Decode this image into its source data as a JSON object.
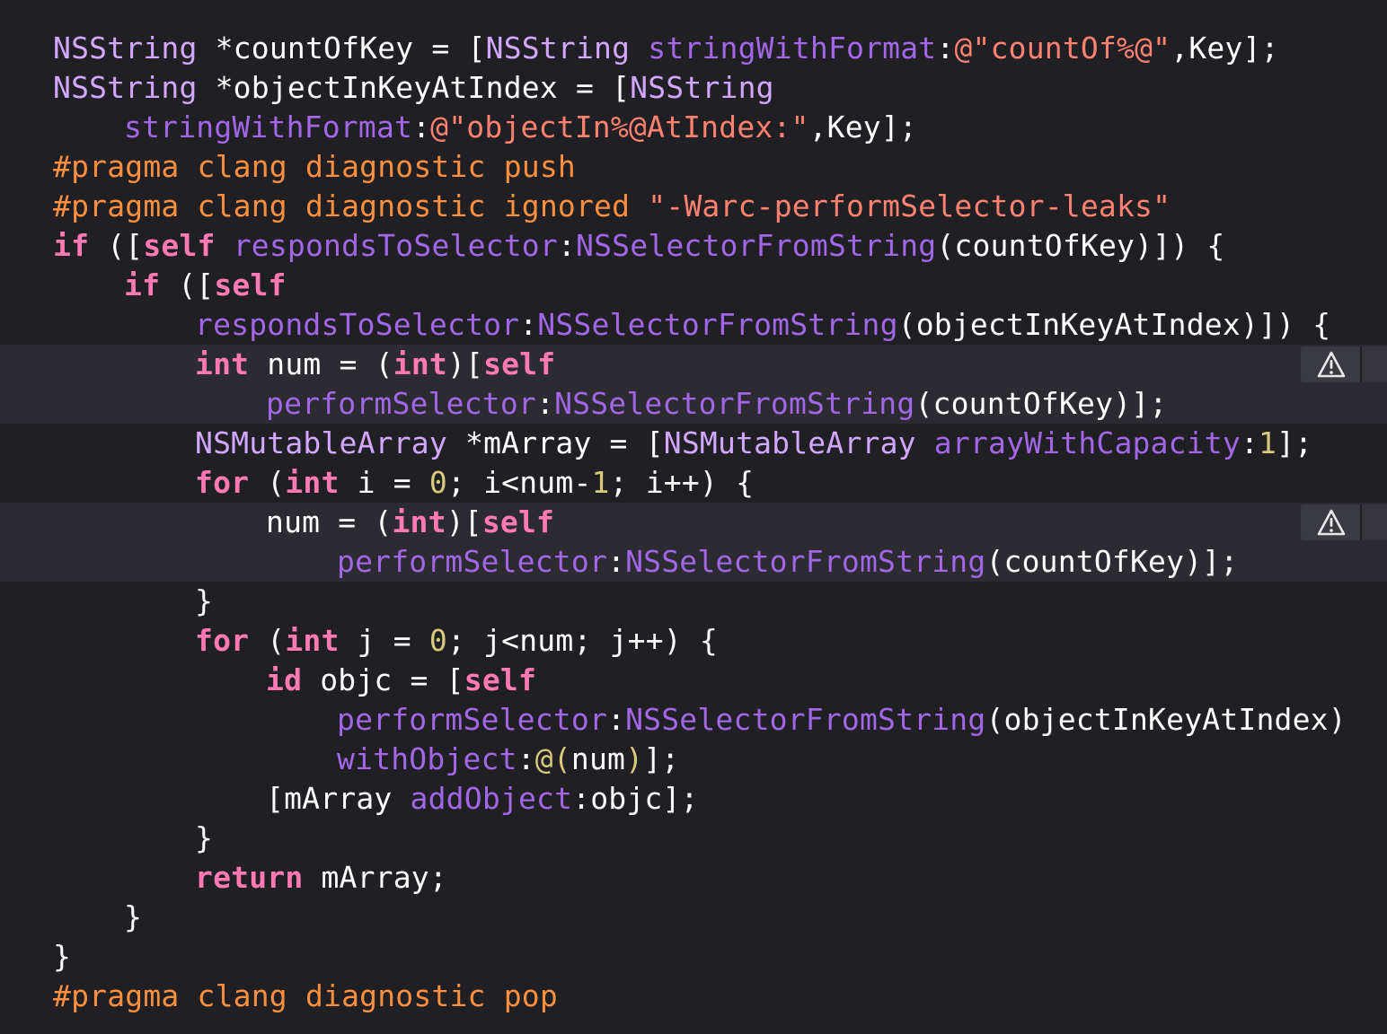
{
  "theme": {
    "background": "#1f1f24",
    "highlight_background": "#2b2b31",
    "plain": "#ffffff",
    "class_name": "#d0a8ff",
    "method": "#a167e6",
    "keyword": "#ff7ab2",
    "string": "#ff8170",
    "number": "#d9c97c",
    "preprocessor": "#fd8f3f",
    "warning_icon": "warning-triangle-icon"
  },
  "code": {
    "lines": [
      {
        "indent": 0,
        "tokens": [
          [
            "cl",
            "NSString"
          ],
          [
            "pl",
            " *countOfKey = ["
          ],
          [
            "cl",
            "NSString"
          ],
          [
            "pl",
            " "
          ],
          [
            "fn",
            "stringWithFormat"
          ],
          [
            "pl",
            ":"
          ],
          [
            "str",
            "@\"countOf%@\""
          ],
          [
            "pl",
            ",Key];"
          ]
        ]
      },
      {
        "indent": 0,
        "tokens": [
          [
            "cl",
            "NSString"
          ],
          [
            "pl",
            " *objectInKeyAtIndex = ["
          ],
          [
            "cl",
            "NSString"
          ]
        ]
      },
      {
        "indent": 1,
        "tokens": [
          [
            "fn",
            "stringWithFormat"
          ],
          [
            "pl",
            ":"
          ],
          [
            "str",
            "@\"objectIn%@AtIndex:\""
          ],
          [
            "pl",
            ",Key];"
          ]
        ]
      },
      {
        "indent": 0,
        "tokens": [
          [
            "pp",
            "#pragma clang diagnostic push"
          ]
        ]
      },
      {
        "indent": 0,
        "tokens": [
          [
            "pp",
            "#pragma clang diagnostic ignored "
          ],
          [
            "str",
            "\"-Warc-performSelector-leaks\""
          ]
        ]
      },
      {
        "indent": 0,
        "tokens": [
          [
            "kw",
            "if"
          ],
          [
            "pl",
            " (["
          ],
          [
            "kw",
            "self"
          ],
          [
            "pl",
            " "
          ],
          [
            "fn",
            "respondsToSelector"
          ],
          [
            "pl",
            ":"
          ],
          [
            "fn",
            "NSSelectorFromString"
          ],
          [
            "pl",
            "(countOfKey)]) {"
          ]
        ]
      },
      {
        "indent": 1,
        "tokens": [
          [
            "kw",
            "if"
          ],
          [
            "pl",
            " (["
          ],
          [
            "kw",
            "self"
          ]
        ]
      },
      {
        "indent": 2,
        "tokens": [
          [
            "fn",
            "respondsToSelector"
          ],
          [
            "pl",
            ":"
          ],
          [
            "fn",
            "NSSelectorFromString"
          ],
          [
            "pl",
            "(objectInKeyAtIndex)]) {"
          ]
        ]
      },
      {
        "indent": 2,
        "tokens": [
          [
            "kw",
            "int"
          ],
          [
            "pl",
            " num = ("
          ],
          [
            "kw",
            "int"
          ],
          [
            "pl",
            ")["
          ],
          [
            "kw",
            "self"
          ]
        ]
      },
      {
        "indent": 3,
        "tokens": [
          [
            "fn",
            "performSelector"
          ],
          [
            "pl",
            ":"
          ],
          [
            "fn",
            "NSSelectorFromString"
          ],
          [
            "pl",
            "(countOfKey)];"
          ]
        ]
      },
      {
        "indent": 2,
        "tokens": [
          [
            "cl",
            "NSMutableArray"
          ],
          [
            "pl",
            " *mArray = ["
          ],
          [
            "cl",
            "NSMutableArray"
          ],
          [
            "pl",
            " "
          ],
          [
            "fn",
            "arrayWithCapacity"
          ],
          [
            "pl",
            ":"
          ],
          [
            "num",
            "1"
          ],
          [
            "pl",
            "];"
          ]
        ]
      },
      {
        "indent": 2,
        "tokens": [
          [
            "kw",
            "for"
          ],
          [
            "pl",
            " ("
          ],
          [
            "kw",
            "int"
          ],
          [
            "pl",
            " i = "
          ],
          [
            "num",
            "0"
          ],
          [
            "pl",
            "; i<num-"
          ],
          [
            "num",
            "1"
          ],
          [
            "pl",
            "; i++) {"
          ]
        ]
      },
      {
        "indent": 3,
        "tokens": [
          [
            "pl",
            "num = ("
          ],
          [
            "kw",
            "int"
          ],
          [
            "pl",
            ")["
          ],
          [
            "kw",
            "self"
          ]
        ]
      },
      {
        "indent": 4,
        "tokens": [
          [
            "fn",
            "performSelector"
          ],
          [
            "pl",
            ":"
          ],
          [
            "fn",
            "NSSelectorFromString"
          ],
          [
            "pl",
            "(countOfKey)];"
          ]
        ]
      },
      {
        "indent": 2,
        "tokens": [
          [
            "pl",
            "}"
          ]
        ]
      },
      {
        "indent": 2,
        "tokens": [
          [
            "kw",
            "for"
          ],
          [
            "pl",
            " ("
          ],
          [
            "kw",
            "int"
          ],
          [
            "pl",
            " j = "
          ],
          [
            "num",
            "0"
          ],
          [
            "pl",
            "; j<num; j++) {"
          ]
        ]
      },
      {
        "indent": 3,
        "tokens": [
          [
            "kw",
            "id"
          ],
          [
            "pl",
            " objc = ["
          ],
          [
            "kw",
            "self"
          ]
        ]
      },
      {
        "indent": 4,
        "tokens": [
          [
            "fn",
            "performSelector"
          ],
          [
            "pl",
            ":"
          ],
          [
            "fn",
            "NSSelectorFromString"
          ],
          [
            "pl",
            "(objectInKeyAtIndex)"
          ]
        ]
      },
      {
        "indent": 4,
        "tokens": [
          [
            "fn",
            "withObject"
          ],
          [
            "pl",
            ":"
          ],
          [
            "num",
            "@("
          ],
          [
            "pl",
            "num"
          ],
          [
            "num",
            ")"
          ],
          [
            "pl",
            "];"
          ]
        ]
      },
      {
        "indent": 3,
        "tokens": [
          [
            "pl",
            "[mArray "
          ],
          [
            "fn",
            "addObject"
          ],
          [
            "pl",
            ":objc];"
          ]
        ]
      },
      {
        "indent": 2,
        "tokens": [
          [
            "pl",
            "}"
          ]
        ]
      },
      {
        "indent": 2,
        "tokens": [
          [
            "kw",
            "return"
          ],
          [
            "pl",
            " mArray;"
          ]
        ]
      },
      {
        "indent": 1,
        "tokens": [
          [
            "pl",
            "}"
          ]
        ]
      },
      {
        "indent": 0,
        "tokens": [
          [
            "pl",
            "}"
          ]
        ]
      },
      {
        "indent": 0,
        "tokens": [
          [
            "pp",
            "#pragma clang diagnostic pop"
          ]
        ]
      }
    ],
    "warnings": [
      {
        "line": 9,
        "icon": "warning-triangle-icon"
      },
      {
        "line": 13,
        "icon": "warning-triangle-icon"
      }
    ]
  }
}
